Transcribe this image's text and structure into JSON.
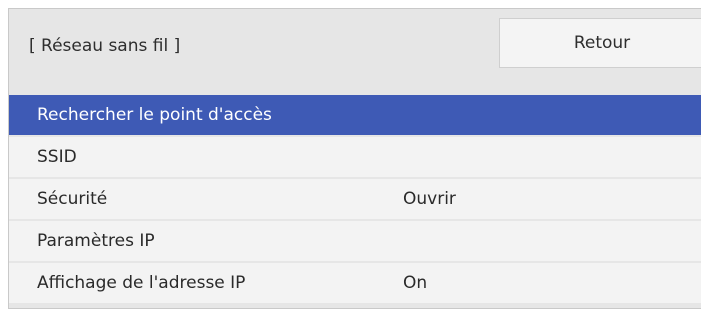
{
  "header": {
    "title": "[ Réseau sans fil ]",
    "back_label": "Retour"
  },
  "menu": {
    "items": [
      {
        "label": "Rechercher le point d'accès",
        "value": "",
        "selected": true
      },
      {
        "label": "SSID",
        "value": "",
        "selected": false
      },
      {
        "label": "Sécurité",
        "value": "Ouvrir",
        "selected": false
      },
      {
        "label": "Paramètres IP",
        "value": "",
        "selected": false
      },
      {
        "label": "Affichage de l'adresse IP",
        "value": "On",
        "selected": false
      }
    ]
  },
  "colors": {
    "selected_row": "#3e5ab5",
    "row_background": "#f3f3f3",
    "panel_background": "#e6e6e6"
  }
}
